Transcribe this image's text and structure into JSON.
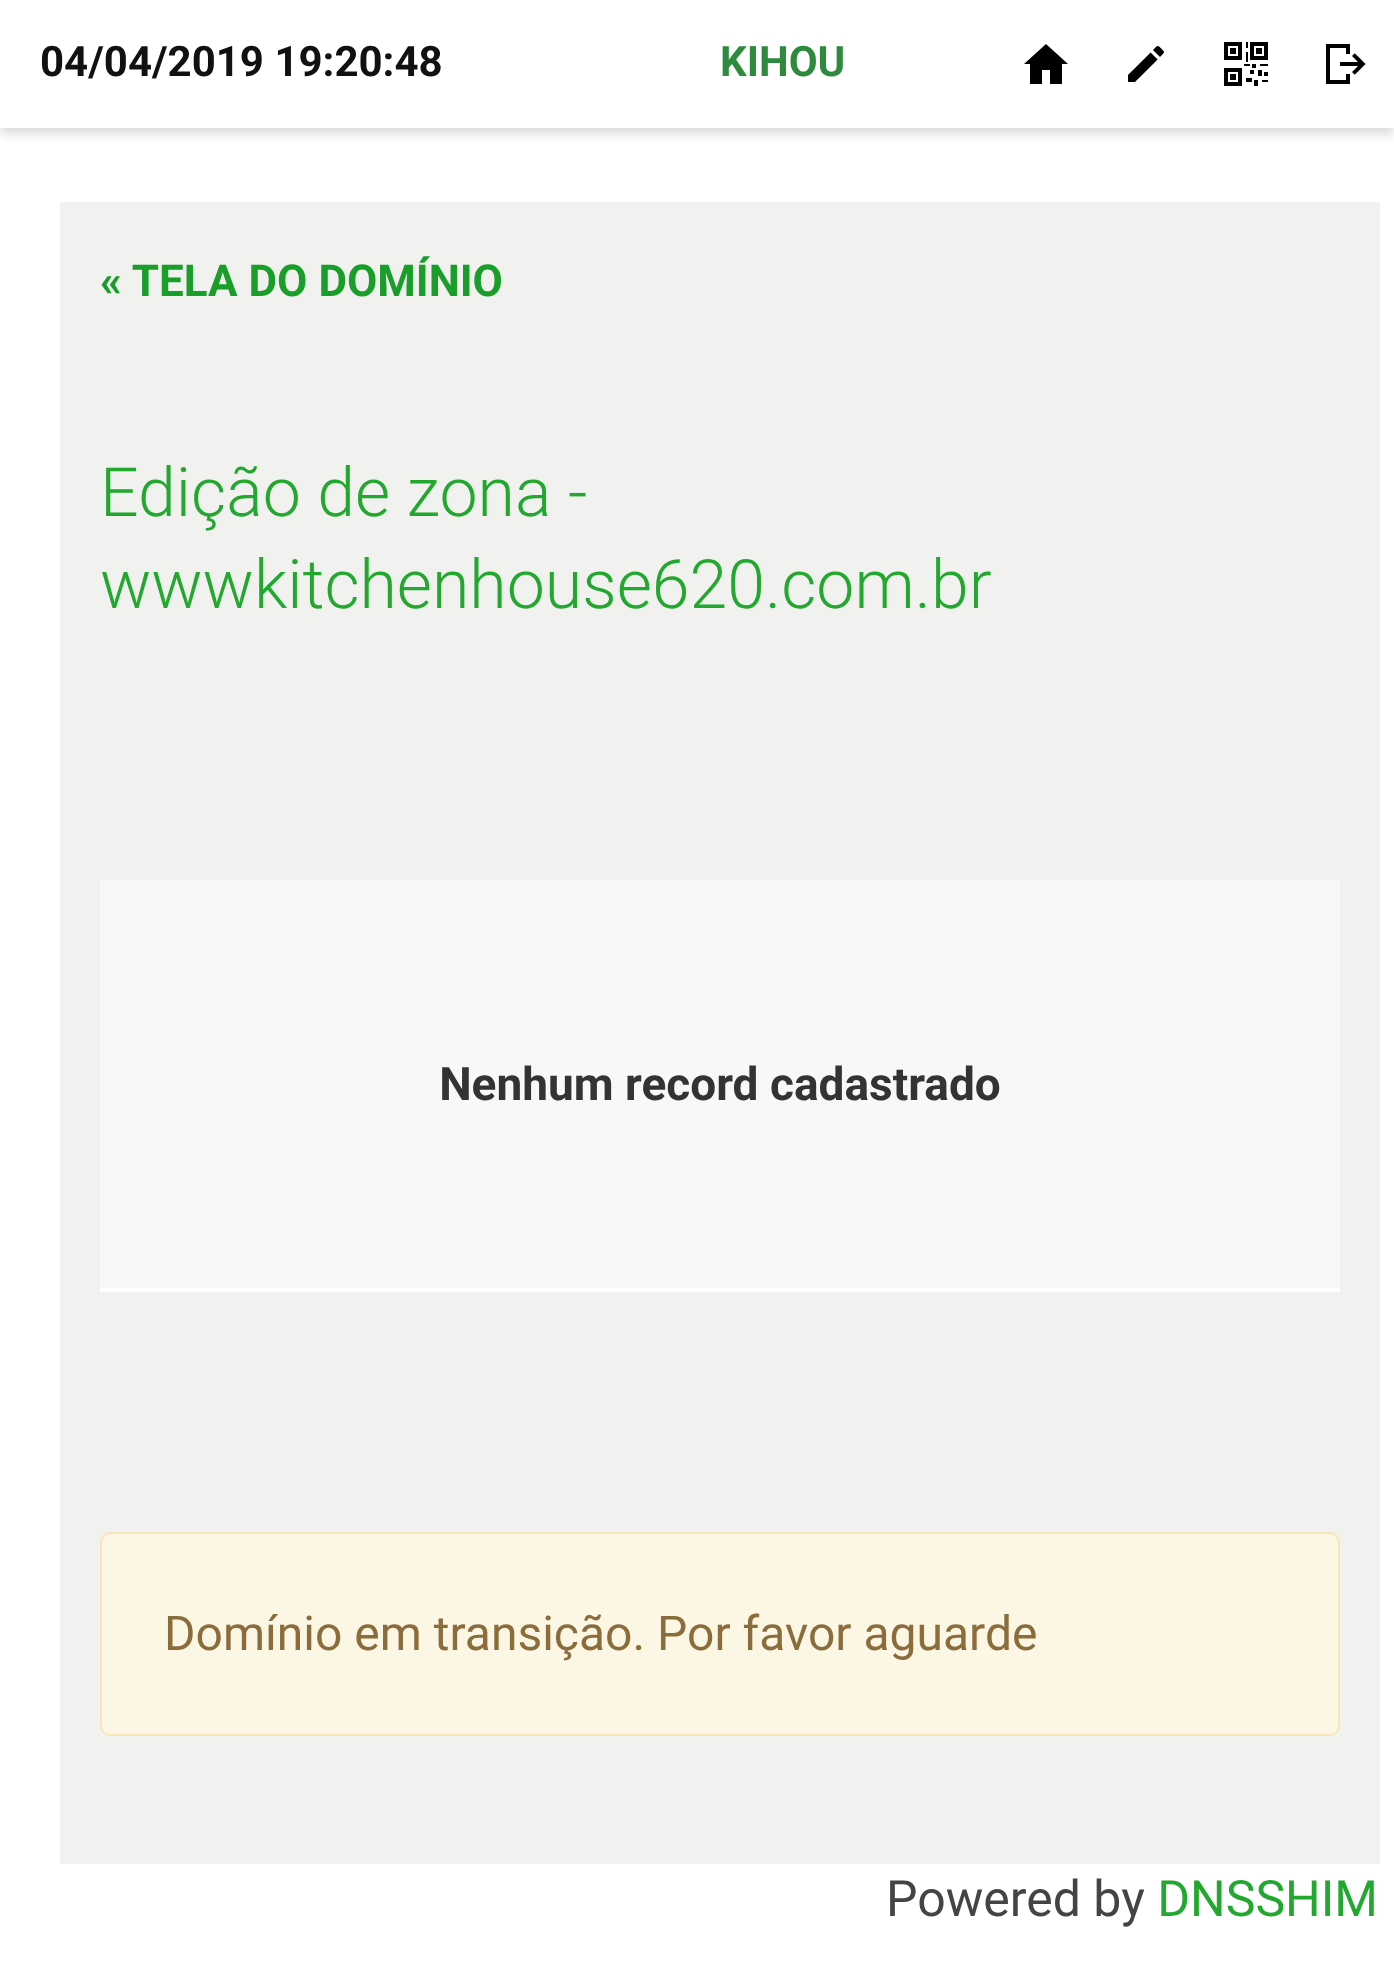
{
  "header": {
    "datetime": "04/04/2019 19:20:48",
    "user": "KIHOU"
  },
  "back_link": "« TELA DO DOMÍNIO",
  "title": "Edição de zona - wwwkitchenhouse620.com.br",
  "records": {
    "empty_message": "Nenhum record cadastrado"
  },
  "alert": "Domínio em transição. Por favor aguarde",
  "footer": {
    "text": "Powered by",
    "link": "DNSSHIM"
  }
}
